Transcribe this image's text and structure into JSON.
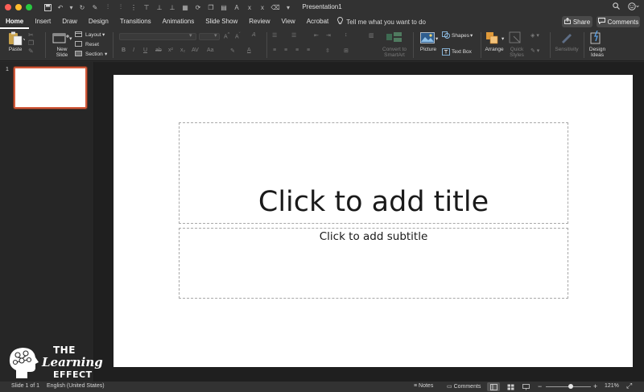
{
  "window": {
    "title": "Presentation1",
    "traffic_colors": [
      "#ff5f57",
      "#febc2e",
      "#28c840"
    ]
  },
  "quick_access_icons": [
    "save-icon",
    "undo-icon",
    "redo-icon",
    "format-painter-icon",
    "align-icon",
    "customize-icon"
  ],
  "tabs": [
    {
      "label": "Home",
      "active": true
    },
    {
      "label": "Insert"
    },
    {
      "label": "Draw"
    },
    {
      "label": "Design"
    },
    {
      "label": "Transitions"
    },
    {
      "label": "Animations"
    },
    {
      "label": "Slide Show"
    },
    {
      "label": "Review"
    },
    {
      "label": "View"
    },
    {
      "label": "Acrobat"
    }
  ],
  "tell_me": "Tell me what you want to do",
  "share_label": "Share",
  "comments_label": "Comments",
  "ribbon": {
    "paste": "Paste",
    "new_slide": "New\nSlide",
    "new_slide_line1": "New",
    "new_slide_line2": "Slide",
    "layout": "Layout",
    "reset": "Reset",
    "section": "Section",
    "convert_line1": "Convert to",
    "convert_line2": "SmartArt",
    "picture": "Picture",
    "shapes": "Shapes",
    "text_box": "Text Box",
    "arrange": "Arrange",
    "quick_styles_line1": "Quick",
    "quick_styles_line2": "Styles",
    "sensitivity": "Sensitivity",
    "design_ideas_line1": "Design",
    "design_ideas_line2": "Ideas"
  },
  "slides_pane": {
    "slide_number": "1"
  },
  "slide": {
    "title_placeholder": "Click to add title",
    "subtitle_placeholder": "Click to add subtitle"
  },
  "logo": {
    "line1": "THE",
    "line2": "Learning",
    "line3": "EFFECT"
  },
  "status": {
    "slide_info": "Slide 1 of 1",
    "language": "English (United States)",
    "notes": "Notes",
    "comments": "Comments",
    "zoom_minus": "−",
    "zoom_plus": "+",
    "zoom": "121%",
    "zoom_fraction": 0.55
  }
}
